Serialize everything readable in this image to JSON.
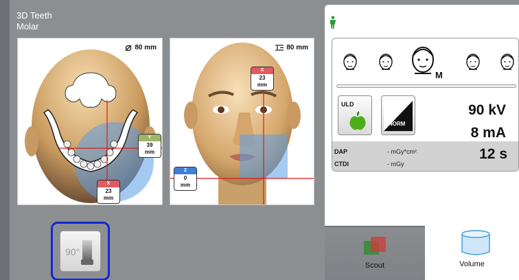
{
  "exam": {
    "title_line1": "3D Teeth",
    "title_line2": "Molar"
  },
  "top_view": {
    "fov_label": "80 mm",
    "badge_y": {
      "axis": "Y",
      "value": "39",
      "unit": "mm"
    },
    "badge_x": {
      "axis": "X",
      "value": "23",
      "unit": "mm"
    }
  },
  "front_view": {
    "fov_label": "80 mm",
    "badge_x": {
      "axis": "X",
      "value": "23",
      "unit": "mm"
    },
    "badge_z": {
      "axis": "Z",
      "value": "0",
      "unit": "mm"
    }
  },
  "rotate_button": {
    "label": "90°"
  },
  "patient": {
    "selected_size_label": "M"
  },
  "exposure": {
    "uld_label": "ULD",
    "norm_label": "NORM",
    "kv": "90 kV",
    "ma": "8 mA",
    "time": "12 s",
    "dap_label": "DAP",
    "dap_value": "- mGy*cm²",
    "ctdi_label": "CTDI",
    "ctdi_value": "- mGy"
  },
  "tabs": {
    "scout": "Scout",
    "volume": "Volume"
  },
  "colors": {
    "selection_outline": "#1526d4",
    "axis_x": "#e15a61",
    "axis_y": "#9fb46a",
    "axis_z": "#3f7fd8",
    "uld_apple": "#4caf1a",
    "person_icon": "#2e9b3a"
  },
  "icons": {
    "fov_top": "diameter-icon",
    "fov_front": "height-icon",
    "person": "person-icon",
    "uld": "apple-icon",
    "norm": "ramp-icon",
    "scout": "scout-icon",
    "volume": "cylinder-icon",
    "rotate": "rotate-90-icon"
  }
}
